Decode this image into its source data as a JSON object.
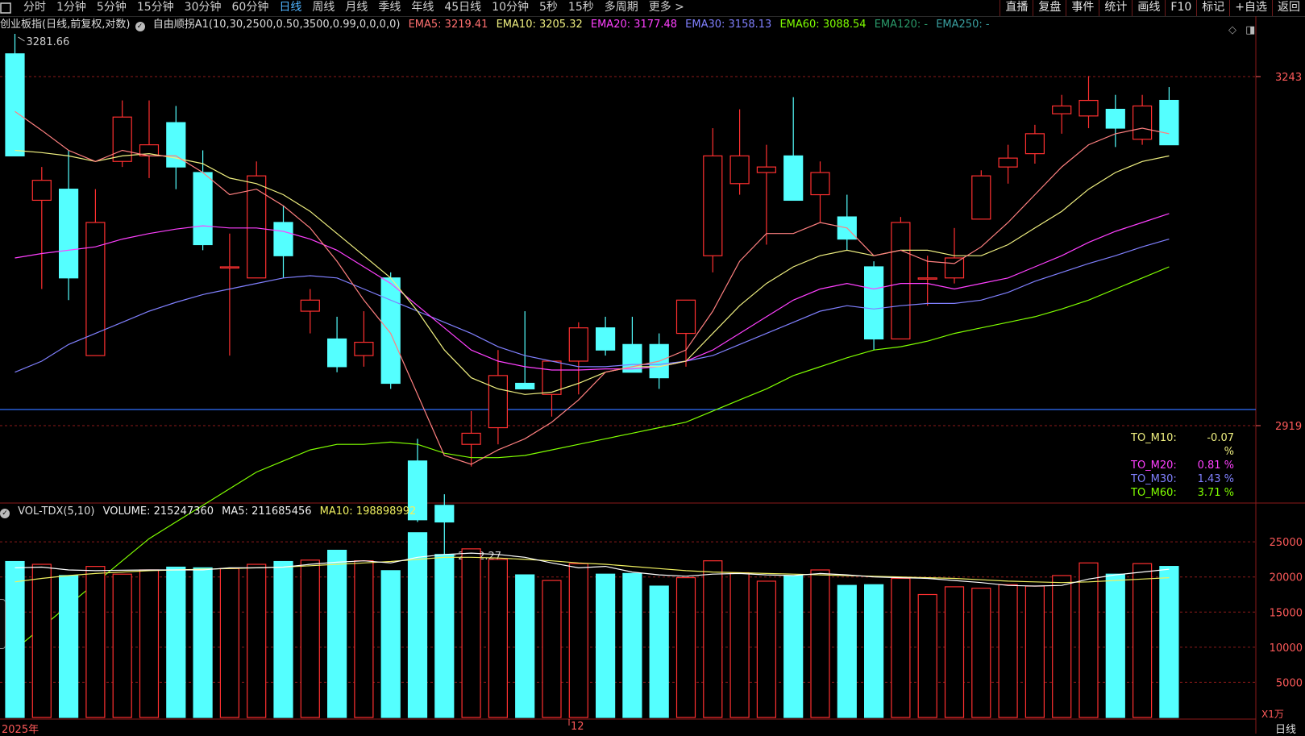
{
  "toolbar": {
    "period_tabs": [
      "分时",
      "1分钟",
      "5分钟",
      "15分钟",
      "30分钟",
      "60分钟",
      "日线",
      "周线",
      "月线",
      "季线",
      "年线",
      "45日线",
      "10分钟",
      "5秒",
      "15秒",
      "多周期",
      "更多 >"
    ],
    "active_tab": "日线",
    "right_buttons": [
      "直播",
      "复盘",
      "事件",
      "统计",
      "画线",
      "F10",
      "标记",
      "+自选",
      "返回"
    ]
  },
  "info_line": {
    "title": "创业板指(日线,前复权,对数)",
    "indicator": "自由顺拐A1(10,30,2500,0.50,3500,0.99,0,0,0,0)",
    "ema5": "EMA5: 3219.41",
    "ema10": "EMA10: 3205.32",
    "ema20": "EMA20: 3177.48",
    "ema30": "EMA30: 3158.13",
    "ema60": "EMA60: 3088.54",
    "ema120": "EMA120: -",
    "ema250": "EMA250: -"
  },
  "annotations": {
    "high_marker": "3281.66",
    "low_marker": "2892.27"
  },
  "price_axis": {
    "top_label": "3243",
    "bottom_label": "2919"
  },
  "to_legend": [
    {
      "key": "TO_M10:",
      "value": "-0.07 %",
      "color": "#f0f080"
    },
    {
      "key": "TO_M20:",
      "value": "0.81 %",
      "color": "#ff40ff"
    },
    {
      "key": "TO_M30:",
      "value": "1.43 %",
      "color": "#8080ff"
    },
    {
      "key": "TO_M60:",
      "value": "3.71 %",
      "color": "#80ff00"
    }
  ],
  "vol_info": {
    "title": "VOL-TDX(5,10)",
    "volume": "VOLUME: 215247360",
    "ma5": "MA5: 211685456",
    "ma10": "MA10: 198898992"
  },
  "vol_axis": {
    "labels": [
      "25000",
      "20000",
      "15000",
      "10000",
      "5000"
    ],
    "unit": "X1万"
  },
  "x_axis": {
    "start": "2025年",
    "mid_label": "12"
  },
  "bottom_right": "日线",
  "colors": {
    "up": "#ff3030",
    "down": "#54ffff",
    "ema5": "#ff8080",
    "ema10": "#f0f080",
    "ema20": "#ff40ff",
    "ema30": "#8080ff",
    "ema60": "#80ff00",
    "grid": "#8b1a1a",
    "hline": "#3070ff"
  },
  "chart_data": {
    "type": "candlestick",
    "price_range": [
      2880,
      3300
    ],
    "candles": [
      {
        "o": 3282,
        "h": 3300,
        "l": 3190,
        "c": 3190
      },
      {
        "o": 3150,
        "h": 3180,
        "l": 3070,
        "c": 3168
      },
      {
        "o": 3160,
        "h": 3195,
        "l": 3060,
        "c": 3080
      },
      {
        "o": 3010,
        "h": 3160,
        "l": 3010,
        "c": 3130
      },
      {
        "o": 3185,
        "h": 3240,
        "l": 3180,
        "c": 3225
      },
      {
        "o": 3190,
        "h": 3240,
        "l": 3170,
        "c": 3200
      },
      {
        "o": 3220,
        "h": 3235,
        "l": 3160,
        "c": 3180
      },
      {
        "o": 3175,
        "h": 3195,
        "l": 3105,
        "c": 3110
      },
      {
        "o": 3090,
        "h": 3120,
        "l": 3010,
        "c": 3090
      },
      {
        "o": 3080,
        "h": 3185,
        "l": 3080,
        "c": 3172
      },
      {
        "o": 3130,
        "h": 3145,
        "l": 3080,
        "c": 3100
      },
      {
        "o": 3050,
        "h": 3070,
        "l": 3030,
        "c": 3060
      },
      {
        "o": 3025,
        "h": 3045,
        "l": 2995,
        "c": 3000
      },
      {
        "o": 3010,
        "h": 3050,
        "l": 3000,
        "c": 3022
      },
      {
        "o": 3080,
        "h": 3085,
        "l": 2980,
        "c": 2985
      },
      {
        "o": 2915,
        "h": 2935,
        "l": 2860,
        "c": 2862
      },
      {
        "o": 2875,
        "h": 2885,
        "l": 2830,
        "c": 2860
      },
      {
        "o": 2930,
        "h": 2960,
        "l": 2910,
        "c": 2940
      },
      {
        "o": 2945,
        "h": 3015,
        "l": 2930,
        "c": 2992
      },
      {
        "o": 2985,
        "h": 3050,
        "l": 2980,
        "c": 2980
      },
      {
        "o": 2975,
        "h": 3005,
        "l": 2955,
        "c": 3005
      },
      {
        "o": 3005,
        "h": 3040,
        "l": 2975,
        "c": 3035
      },
      {
        "o": 3035,
        "h": 3045,
        "l": 3010,
        "c": 3015
      },
      {
        "o": 3020,
        "h": 3045,
        "l": 2995,
        "c": 2995
      },
      {
        "o": 3020,
        "h": 3030,
        "l": 2980,
        "c": 2990
      },
      {
        "o": 3030,
        "h": 3060,
        "l": 3000,
        "c": 3060
      },
      {
        "o": 3100,
        "h": 3215,
        "l": 3085,
        "c": 3190
      },
      {
        "o": 3165,
        "h": 3232,
        "l": 3155,
        "c": 3190
      },
      {
        "o": 3175,
        "h": 3200,
        "l": 3110,
        "c": 3180
      },
      {
        "o": 3190,
        "h": 3243,
        "l": 3150,
        "c": 3150
      },
      {
        "o": 3155,
        "h": 3185,
        "l": 3130,
        "c": 3175
      },
      {
        "o": 3135,
        "h": 3155,
        "l": 3105,
        "c": 3115
      },
      {
        "o": 3090,
        "h": 3095,
        "l": 3015,
        "c": 3025
      },
      {
        "o": 3025,
        "h": 3135,
        "l": 3025,
        "c": 3130
      },
      {
        "o": 3080,
        "h": 3100,
        "l": 3055,
        "c": 3080
      },
      {
        "o": 3080,
        "h": 3125,
        "l": 3075,
        "c": 3098
      },
      {
        "o": 3133,
        "h": 3177,
        "l": 3133,
        "c": 3172
      },
      {
        "o": 3180,
        "h": 3200,
        "l": 3165,
        "c": 3188
      },
      {
        "o": 3192,
        "h": 3218,
        "l": 3183,
        "c": 3210
      },
      {
        "o": 3228,
        "h": 3245,
        "l": 3210,
        "c": 3235
      },
      {
        "o": 3226,
        "h": 3262,
        "l": 3215,
        "c": 3240
      },
      {
        "o": 3232,
        "h": 3245,
        "l": 3198,
        "c": 3215
      },
      {
        "o": 3205,
        "h": 3245,
        "l": 3200,
        "c": 3235
      },
      {
        "o": 3240,
        "h": 3252,
        "l": 3200,
        "c": 3200
      }
    ],
    "ema5": [
      3230,
      3213,
      3195,
      3185,
      3195,
      3190,
      3190,
      3175,
      3155,
      3160,
      3145,
      3125,
      3095,
      3060,
      3030,
      2975,
      2920,
      2912,
      2925,
      2935,
      2950,
      2970,
      2995,
      3000,
      3005,
      3015,
      3050,
      3095,
      3120,
      3120,
      3130,
      3125,
      3100,
      3105,
      3095,
      3093,
      3108,
      3130,
      3155,
      3180,
      3200,
      3210,
      3215,
      3210
    ],
    "ema10": [
      3195,
      3193,
      3190,
      3185,
      3190,
      3192,
      3188,
      3183,
      3170,
      3165,
      3155,
      3140,
      3120,
      3100,
      3080,
      3050,
      3015,
      2990,
      2980,
      2975,
      2977,
      2985,
      2995,
      3000,
      3000,
      3005,
      3030,
      3055,
      3075,
      3090,
      3100,
      3105,
      3100,
      3105,
      3105,
      3100,
      3100,
      3110,
      3125,
      3140,
      3160,
      3175,
      3185,
      3190
    ],
    "ema20": [
      3098,
      3102,
      3105,
      3108,
      3115,
      3120,
      3124,
      3127,
      3125,
      3125,
      3122,
      3115,
      3105,
      3090,
      3075,
      3055,
      3035,
      3015,
      3005,
      3000,
      2997,
      2997,
      2998,
      2998,
      3000,
      3005,
      3015,
      3030,
      3045,
      3060,
      3070,
      3075,
      3070,
      3075,
      3075,
      3070,
      3075,
      3080,
      3090,
      3100,
      3112,
      3122,
      3130,
      3138
    ],
    "ema30": [
      2995,
      3005,
      3020,
      3030,
      3040,
      3050,
      3058,
      3065,
      3070,
      3075,
      3080,
      3082,
      3080,
      3070,
      3060,
      3050,
      3040,
      3030,
      3018,
      3010,
      3005,
      3000,
      3000,
      3002,
      3002,
      3005,
      3010,
      3020,
      3030,
      3040,
      3050,
      3055,
      3052,
      3055,
      3057,
      3057,
      3060,
      3067,
      3077,
      3085,
      3093,
      3100,
      3108,
      3115
    ],
    "ema60": [
      2745,
      2765,
      2785,
      2805,
      2825,
      2845,
      2860,
      2875,
      2890,
      2905,
      2915,
      2925,
      2930,
      2930,
      2932,
      2930,
      2922,
      2918,
      2918,
      2920,
      2925,
      2930,
      2935,
      2940,
      2945,
      2950,
      2960,
      2970,
      2980,
      2992,
      3000,
      3008,
      3015,
      3018,
      3023,
      3030,
      3035,
      3040,
      3045,
      3052,
      3060,
      3070,
      3080,
      3090
    ],
    "volume": [
      22200,
      21800,
      20200,
      21500,
      20400,
      21000,
      21400,
      21300,
      21200,
      21800,
      22200,
      22400,
      23800,
      22300,
      20900,
      26300,
      23200,
      24000,
      22500,
      20300,
      19500,
      21900,
      20400,
      20500,
      18700,
      19900,
      22300,
      20600,
      19400,
      20200,
      21000,
      18800,
      18900,
      19800,
      17500,
      18600,
      18400,
      18900,
      18700,
      20200,
      22000,
      20400,
      21900,
      21500
    ],
    "vol_ma5": [
      21300,
      21400,
      21000,
      20900,
      20950,
      21000,
      21000,
      21000,
      21300,
      21300,
      21400,
      21800,
      22100,
      22300,
      22000,
      22800,
      23200,
      23400,
      23200,
      22800,
      22000,
      21300,
      21500,
      20700,
      20300,
      20100,
      20400,
      20500,
      20300,
      20200,
      20500,
      20300,
      20000,
      19900,
      19800,
      19500,
      19200,
      18800,
      18700,
      18800,
      19700,
      20300,
      20700,
      21100
    ],
    "vol_ma10": [
      19300,
      19800,
      20200,
      20500,
      20700,
      20900,
      21000,
      21100,
      21200,
      21300,
      21400,
      21600,
      21800,
      22000,
      22200,
      22500,
      22800,
      22800,
      22700,
      22500,
      22300,
      22000,
      21800,
      21500,
      21200,
      20900,
      20700,
      20600,
      20500,
      20400,
      20300,
      20200,
      20100,
      20000,
      19900,
      19800,
      19600,
      19400,
      19300,
      19200,
      19300,
      19500,
      19700,
      19900
    ]
  }
}
